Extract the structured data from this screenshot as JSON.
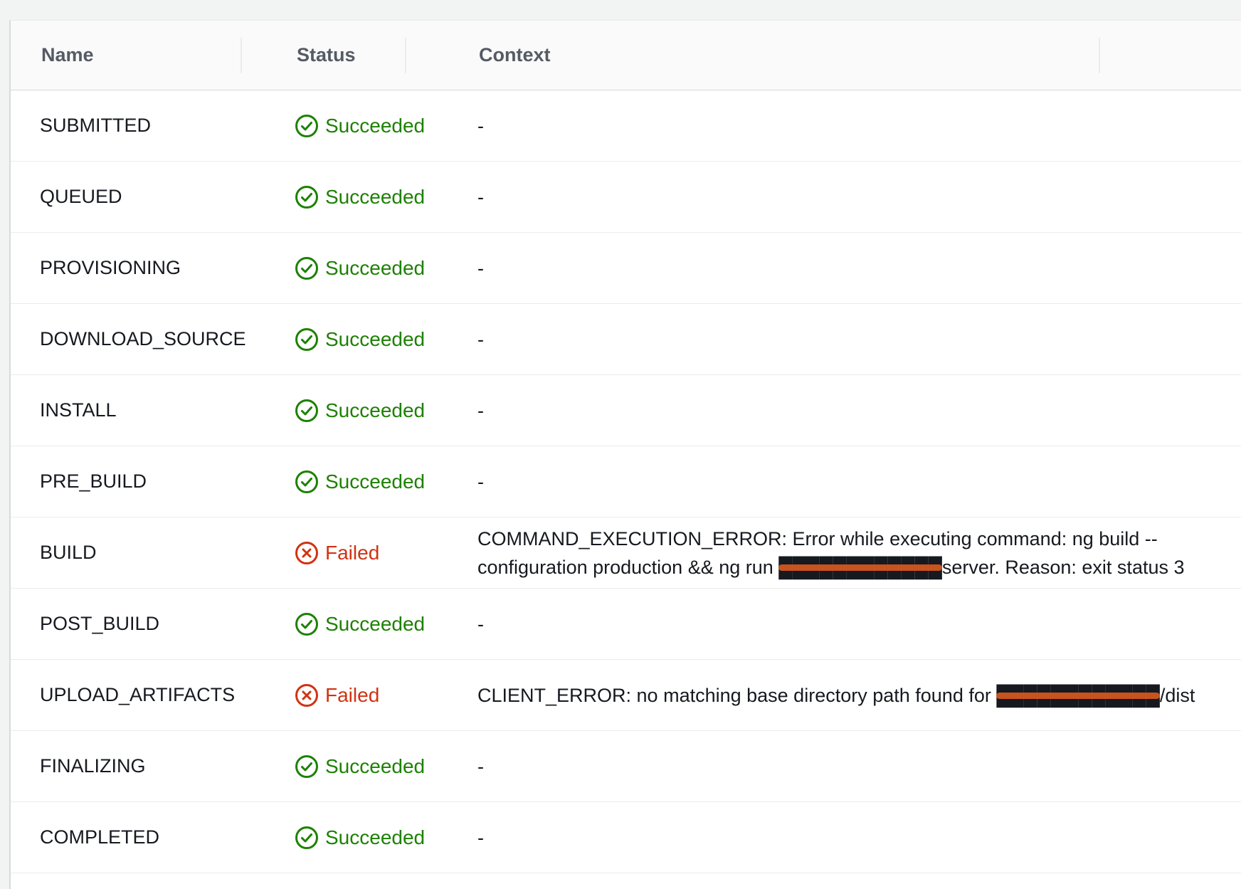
{
  "table": {
    "columns": {
      "name": "Name",
      "status": "Status",
      "context": "Context"
    },
    "rows": [
      {
        "name": "SUBMITTED",
        "status": "Succeeded",
        "status_type": "success",
        "context": "-"
      },
      {
        "name": "QUEUED",
        "status": "Succeeded",
        "status_type": "success",
        "context": "-"
      },
      {
        "name": "PROVISIONING",
        "status": "Succeeded",
        "status_type": "success",
        "context": "-"
      },
      {
        "name": "DOWNLOAD_SOURCE",
        "status": "Succeeded",
        "status_type": "success",
        "context": "-"
      },
      {
        "name": "INSTALL",
        "status": "Succeeded",
        "status_type": "success",
        "context": "-"
      },
      {
        "name": "PRE_BUILD",
        "status": "Succeeded",
        "status_type": "success",
        "context": "-"
      },
      {
        "name": "BUILD",
        "status": "Failed",
        "status_type": "error",
        "context": "COMMAND_EXECUTION_ERROR: Error while executing command: ng build --configuration production && ng run ████████████server. Reason: exit status 3"
      },
      {
        "name": "POST_BUILD",
        "status": "Succeeded",
        "status_type": "success",
        "context": "-"
      },
      {
        "name": "UPLOAD_ARTIFACTS",
        "status": "Failed",
        "status_type": "error",
        "context": "CLIENT_ERROR: no matching base directory path found for ████████████/dist"
      },
      {
        "name": "FINALIZING",
        "status": "Succeeded",
        "status_type": "success",
        "context": "-"
      },
      {
        "name": "COMPLETED",
        "status": "Succeeded",
        "status_type": "success",
        "context": "-"
      }
    ]
  },
  "colors": {
    "success": "#1d8102",
    "error": "#d13212",
    "redaction": "#c8531e"
  },
  "icons": {
    "success": "check-circle-icon",
    "error": "x-circle-icon"
  }
}
